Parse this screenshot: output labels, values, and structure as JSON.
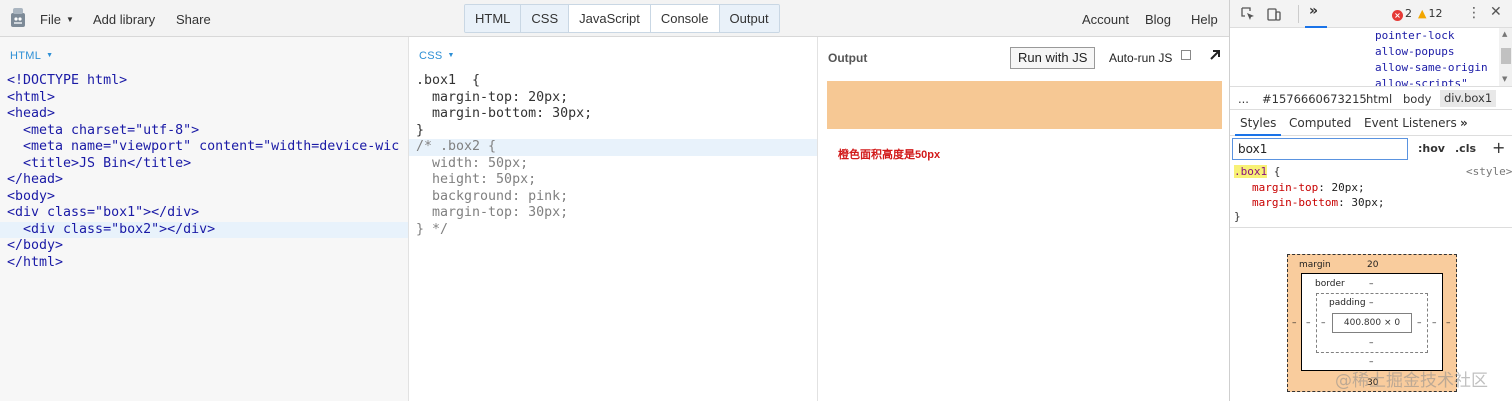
{
  "menubar": {
    "file_label": "File",
    "add_library_label": "Add library",
    "share_label": "Share",
    "account_label": "Account",
    "blog_label": "Blog",
    "help_label": "Help"
  },
  "panel_tabs": [
    "HTML",
    "CSS",
    "JavaScript",
    "Console",
    "Output"
  ],
  "html_panel": {
    "header": "HTML",
    "lines": [
      "<!DOCTYPE html>",
      "<html>",
      "<head>",
      "  <meta charset=\"utf-8\">",
      "  <meta name=\"viewport\" content=\"width=device-wic",
      "  <title>JS Bin</title>",
      "</head>",
      "<body>",
      "<div class=\"box1\"></div>",
      "  <div class=\"box2\"></div>",
      "</body>",
      "</html>"
    ]
  },
  "css_panel": {
    "header": "CSS",
    "lines": [
      ".box1  {",
      "  margin-top: 20px;",
      "  margin-bottom: 30px;",
      "}",
      "/* .box2 {",
      "  width: 50px;",
      "  height: 50px;",
      "  background: pink;",
      "  margin-top: 30px;",
      "} */"
    ]
  },
  "output_panel": {
    "title": "Output",
    "run_button": "Run with JS",
    "autorun_label": "Auto-run JS",
    "block_color": "#f6c894",
    "note": "橙色面积高度是50px"
  },
  "devtools": {
    "error_count": "2",
    "warning_count": "12",
    "dom_lines": [
      "pointer-lock",
      "allow-popups",
      "allow-same-origin",
      "allow-scripts\""
    ],
    "breadcrumbs": [
      "...",
      "#1576660673215",
      "html",
      "body",
      "div.box1"
    ],
    "style_tabs": [
      "Styles",
      "Computed",
      "Event Listeners"
    ],
    "filter_value": "box1",
    "hov_label": ":hov",
    "cls_label": ".cls",
    "rule_selector": ".box1",
    "rule_source": "<style>",
    "declarations": [
      {
        "name": "margin-top",
        "value": "20px;"
      },
      {
        "name": "margin-bottom",
        "value": "30px;"
      }
    ],
    "box_model": {
      "margin_label": "margin",
      "margin_top": "20",
      "margin_bottom": "30",
      "border_label": "border",
      "padding_label": "padding",
      "dash": "–",
      "content_size": "400.800 × 0"
    }
  },
  "watermark": "@稀土掘金技术社区"
}
